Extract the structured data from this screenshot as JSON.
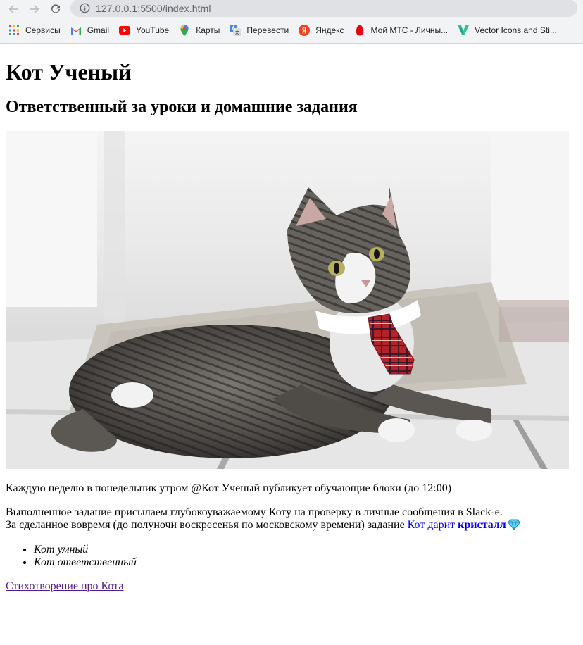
{
  "browser": {
    "url": "127.0.0.1:5500/index.html",
    "bookmarks": [
      {
        "label": "Сервисы",
        "icon": "apps-grid-icon"
      },
      {
        "label": "Gmail",
        "icon": "gmail-icon"
      },
      {
        "label": "YouTube",
        "icon": "youtube-icon"
      },
      {
        "label": "Карты",
        "icon": "maps-icon"
      },
      {
        "label": "Перевести",
        "icon": "translate-icon"
      },
      {
        "label": "Яндекс",
        "icon": "yandex-icon"
      },
      {
        "label": "Мой МТС - Личны...",
        "icon": "mts-icon"
      },
      {
        "label": "Vector Icons and Sti...",
        "icon": "vector-icons-icon"
      }
    ]
  },
  "page": {
    "title": "Кот Ученый",
    "subtitle": "Ответственный за уроки и домашние задания",
    "paragraph1": "Каждую неделю в понедельник утром @Кот Ученый публикует обучающие блоки (до 12:00)",
    "paragraph2_line1": "Выполненное задание присылаем глубокоуважаемому Коту на проверку в личные сообщения в Slack-е.",
    "paragraph2_line2": "За сделанное вовремя (до полуночи воскресенья по московскому времени) задание ",
    "link_text": "Кот дарит ",
    "link_bold": "кристалл",
    "list": [
      "Кот умный",
      "Кот ответственный"
    ],
    "poem_link": "Стихотворение про Кота"
  },
  "colors": {
    "link": "#0000ee",
    "visited_link": "#551a8b",
    "gem": "#5fd3f3"
  }
}
